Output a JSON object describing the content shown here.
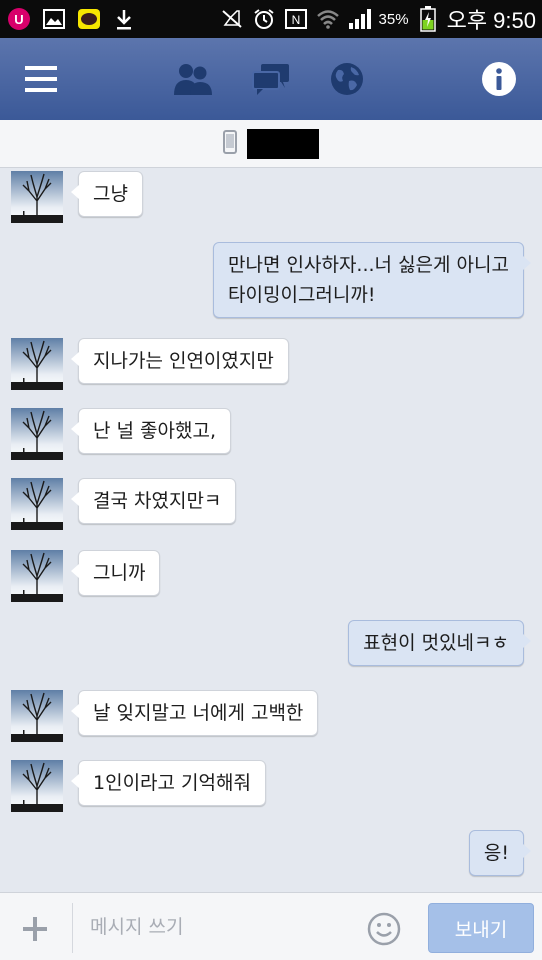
{
  "status_bar": {
    "battery": "35%",
    "clock": "오후 9:50"
  },
  "contact": {
    "name": ""
  },
  "messages": [
    {
      "side": "in",
      "text": "그냥"
    },
    {
      "side": "out",
      "text": "만나면 인사하자...너 싫은게 아니고\n타이밍이그러니까!"
    },
    {
      "side": "in",
      "text": "지나가는 인연이였지만"
    },
    {
      "side": "in",
      "text": "난 널 좋아했고,"
    },
    {
      "side": "in",
      "text": "결국 차였지만ㅋ"
    },
    {
      "side": "in",
      "text": "그니까"
    },
    {
      "side": "out",
      "text": "표현이 멋있네ㅋㅎ"
    },
    {
      "side": "in",
      "text": "날 잊지말고 너에게 고백한"
    },
    {
      "side": "in",
      "text": "1인이라고 기억해줘"
    },
    {
      "side": "out",
      "text": "응!"
    }
  ],
  "composer": {
    "placeholder": "메시지 쓰기",
    "value": "",
    "send_label": "보내기"
  },
  "icons": {
    "carrier": "lg-u-plus-icon",
    "menu": "hamburger-menu-icon",
    "friends": "friends-icon",
    "chat": "chat-bubbles-icon",
    "globe": "globe-icon",
    "info": "info-icon",
    "phone": "mobile-phone-icon",
    "add": "plus-icon",
    "emoji": "smiley-icon"
  },
  "colors": {
    "nav": "#3b5998",
    "incoming_bubble": "#ffffff",
    "outgoing_bubble": "#dae4f3",
    "send_button": "#a5c0e8"
  }
}
